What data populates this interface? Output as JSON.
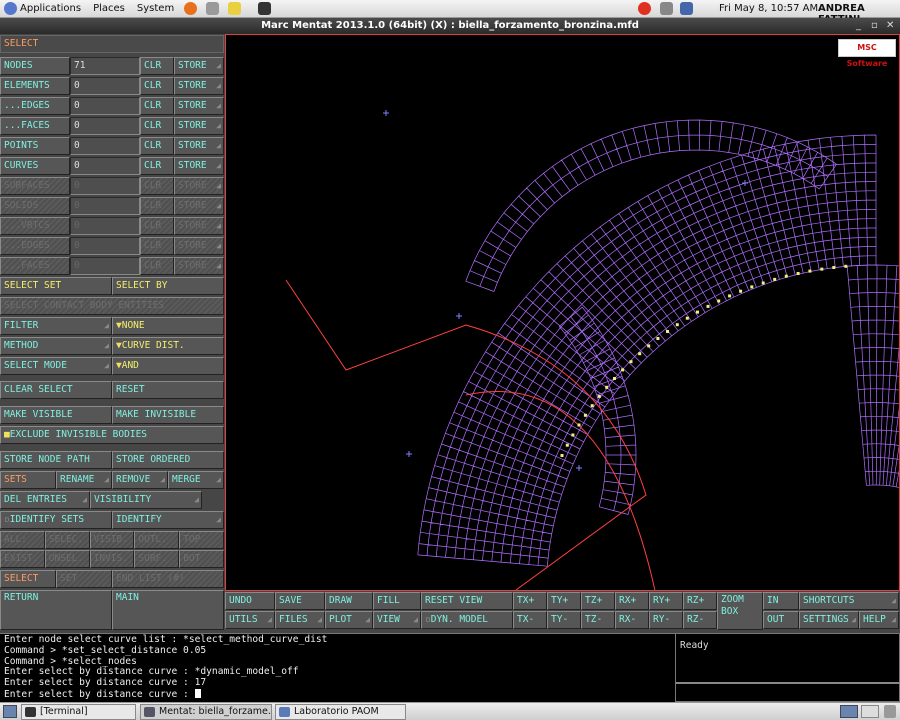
{
  "topbar": {
    "applications": "Applications",
    "places": "Places",
    "system": "System",
    "datetime": "Fri May  8, 10:57 AM",
    "user": "ANDREA FATTINI"
  },
  "window": {
    "title": "Marc Mentat 2013.1.0 (64bit) (X) : biella_forzamento_bronzina.mfd",
    "min": "_",
    "max": "▫",
    "close": "✕"
  },
  "panel": {
    "header": "SELECT",
    "rows": [
      {
        "label": "NODES",
        "value": "71",
        "clr": "CLR",
        "store": "STORE"
      },
      {
        "label": "ELEMENTS",
        "value": "0",
        "clr": "CLR",
        "store": "STORE"
      },
      {
        "label": "...EDGES",
        "value": "0",
        "clr": "CLR",
        "store": "STORE"
      },
      {
        "label": "...FACES",
        "value": "0",
        "clr": "CLR",
        "store": "STORE"
      },
      {
        "label": "POINTS",
        "value": "0",
        "clr": "CLR",
        "store": "STORE"
      },
      {
        "label": "CURVES",
        "value": "0",
        "clr": "CLR",
        "store": "STORE"
      },
      {
        "label": "SURFACES",
        "value": "0",
        "clr": "CLR",
        "store": "STORE"
      },
      {
        "label": "SOLIDS",
        "value": "0",
        "clr": "CLR",
        "store": "STORE"
      },
      {
        "label": "...VRTCS",
        "value": "0",
        "clr": "CLR",
        "store": "STORE"
      },
      {
        "label": "...EDGES",
        "value": "0",
        "clr": "CLR",
        "store": "STORE"
      },
      {
        "label": "...FACES",
        "value": "0",
        "clr": "CLR",
        "store": "STORE"
      }
    ],
    "select_set": "SELECT SET",
    "select_by": "SELECT BY",
    "select_contact": "SELECT CONTACT BODY ENTITIES",
    "filter": "FILTER",
    "filter_val": "NONE",
    "method": "METHOD",
    "method_val": "CURVE DIST.",
    "select_mode": "SELECT MODE",
    "select_mode_val": "AND",
    "clear_select": "CLEAR SELECT",
    "reset": "RESET",
    "make_visible": "MAKE VISIBLE",
    "make_invisible": "MAKE INVISIBLE",
    "exclude_invisible": "EXCLUDE INVISIBLE BODIES",
    "store_node_path": "STORE NODE PATH",
    "store_ordered": "STORE ORDERED",
    "sets": "SETS",
    "rename": "RENAME",
    "remove": "REMOVE",
    "merge": "MERGE",
    "del_entries": "DEL ENTRIES",
    "visibility": "VISIBILITY",
    "identify_sets": "IDENTIFY SETS",
    "identify": "IDENTIFY",
    "r1": [
      "ALL:",
      "SELEC.",
      "VISIB.",
      "OUTL.",
      "TOP"
    ],
    "r2": [
      "EXIST.",
      "UNSEL.",
      "INVIS.",
      "SURF.",
      "BOT"
    ],
    "select": "SELECT",
    "set": "SET",
    "end_list": "END LIST (#)",
    "return": "RETURN",
    "main": "MAIN"
  },
  "toolbar": {
    "undo": "UNDO",
    "save": "SAVE",
    "draw": "DRAW",
    "fill": "FILL",
    "reset_view": "RESET VIEW",
    "txp": "TX+",
    "typ": "TY+",
    "tzp": "TZ+",
    "rxp": "RX+",
    "ryp": "RY+",
    "rzp": "RZ+",
    "zoom_box": "ZOOM BOX",
    "in": "IN",
    "shortcuts": "SHORTCUTS",
    "utils": "UTILS",
    "files": "FILES",
    "plot": "PLOT",
    "view": "VIEW",
    "dyn_model": "DYN. MODEL",
    "txm": "TX-",
    "tym": "TY-",
    "tzm": "TZ-",
    "rxm": "RX-",
    "rym": "RY-",
    "rzm": "RZ-",
    "out": "OUT",
    "settings": "SETTINGS",
    "help": "HELP"
  },
  "console": {
    "lines": [
      "Enter node select curve list : *select_method_curve_dist",
      "Command > *set_select_distance 0.05",
      "Command > *select_nodes",
      "Enter select by distance curve : *dynamic_model_off",
      "Enter select by distance curve :  17",
      "Enter select by distance curve : "
    ]
  },
  "status": {
    "text": "Ready"
  },
  "logo": "MSC Software",
  "taskbar": {
    "terminal": "[Terminal]",
    "mentat": "Mentat: biella_forzame...",
    "lab": "Laboratorio PAOM"
  },
  "colors": {
    "mesh": "#b070ff",
    "curve": "#ff4040",
    "selected_node": "#f0f080",
    "panel": "#464646",
    "label_text": "#7ff0e0"
  }
}
